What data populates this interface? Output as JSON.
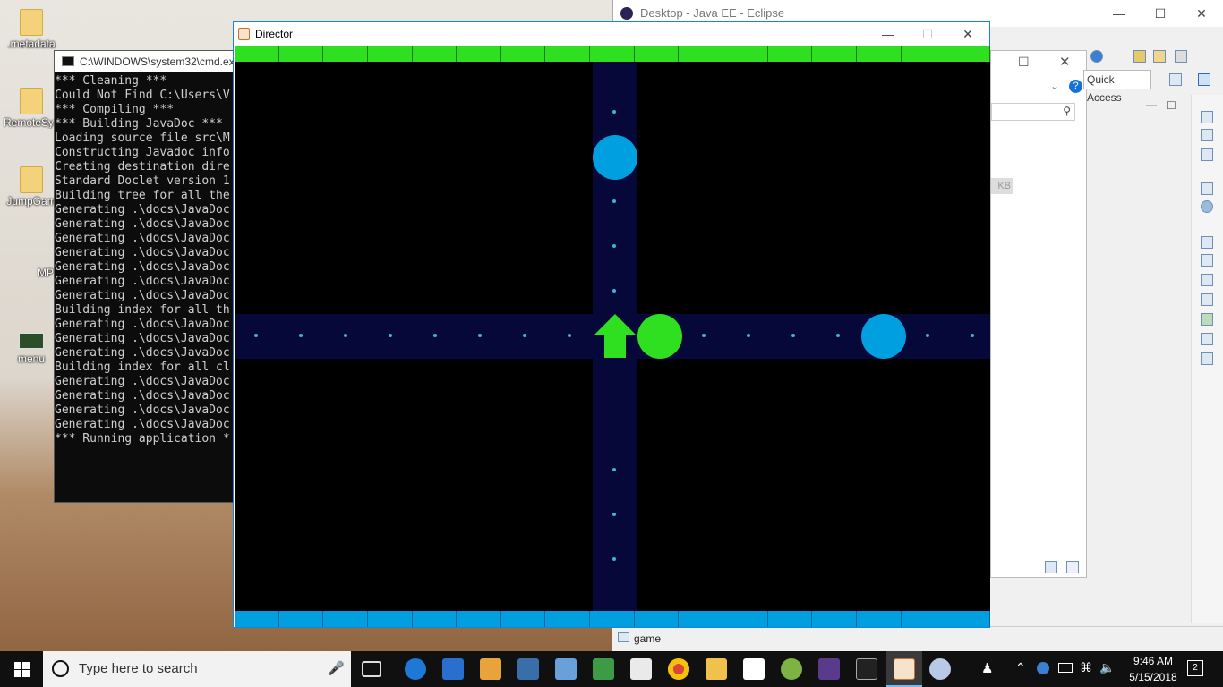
{
  "desktop": {
    "icons": [
      {
        "label": ".metadata"
      },
      {
        "label": "RemoteSys"
      },
      {
        "label": "JumpGam"
      },
      {
        "label": "MP"
      },
      {
        "label": "menu"
      }
    ]
  },
  "cmd": {
    "title": "C:\\WINDOWS\\system32\\cmd.ex",
    "lines": [
      "*** Cleaning ***",
      "Could Not Find C:\\Users\\V",
      "*** Compiling ***",
      "*** Building JavaDoc ***",
      "Loading source file src\\M",
      "Constructing Javadoc info",
      "Creating destination dire",
      "Standard Doclet version 1",
      "Building tree for all the",
      "Generating .\\docs\\JavaDoc",
      "Generating .\\docs\\JavaDoc",
      "Generating .\\docs\\JavaDoc",
      "Generating .\\docs\\JavaDoc",
      "Generating .\\docs\\JavaDoc",
      "Generating .\\docs\\JavaDoc",
      "Generating .\\docs\\JavaDoc",
      "Building index for all th",
      "Generating .\\docs\\JavaDoc",
      "Generating .\\docs\\JavaDoc",
      "Generating .\\docs\\JavaDoc",
      "Building index for all cl",
      "Generating .\\docs\\JavaDoc",
      "Generating .\\docs\\JavaDoc",
      "Generating .\\docs\\JavaDoc",
      "Generating .\\docs\\JavaDoc",
      "*** Running application *"
    ]
  },
  "eclipse": {
    "title": "Desktop - Java EE - Eclipse",
    "quick_access": "Quick Access",
    "kb_label": "KB",
    "status_item": "game"
  },
  "director": {
    "title": "Director",
    "colors": {
      "top_bar": "#2fe020",
      "bottom_bar": "#00a0e0",
      "lane": "#06083a",
      "pellet": "#3fb2d7",
      "player": "#2fe020",
      "ghost": "#00a0e0",
      "green_ball": "#2fe020"
    },
    "bar_segments": 17,
    "player": {
      "facing": "up",
      "shape": "arrow"
    }
  },
  "taskbar": {
    "search_placeholder": "Type here to search",
    "time": "9:46 AM",
    "date": "5/15/2018",
    "notification_count": "2"
  }
}
